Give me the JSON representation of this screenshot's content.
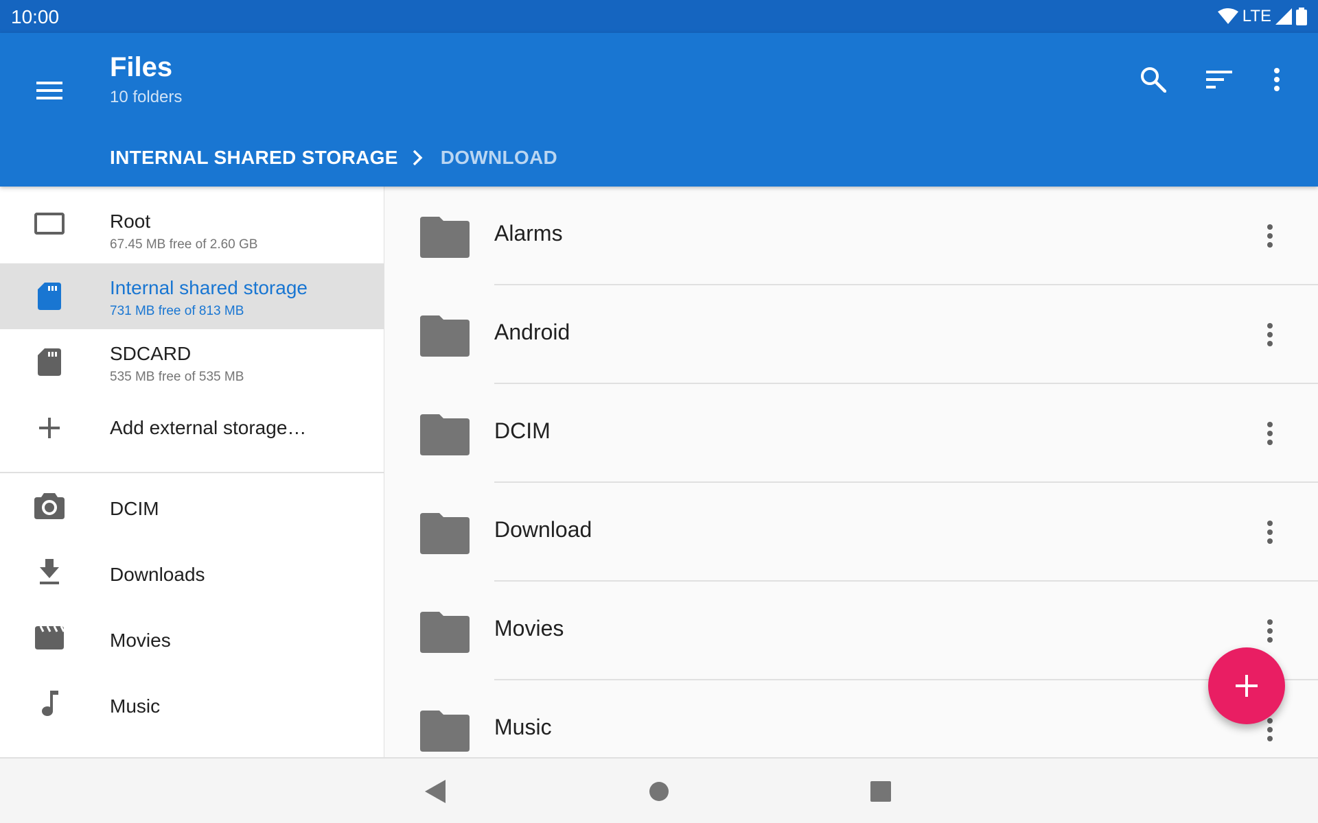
{
  "status_bar": {
    "time": "10:00",
    "network": "LTE",
    "icons": [
      "wifi-icon",
      "signal-icon",
      "battery-icon"
    ]
  },
  "app_bar": {
    "title": "Files",
    "subtitle": "10 folders",
    "actions": [
      "search-icon",
      "sort-icon",
      "more-vert-icon"
    ],
    "breadcrumbs": [
      "INTERNAL SHARED STORAGE",
      "DOWNLOAD"
    ]
  },
  "drawer": {
    "storage": [
      {
        "label": "Root",
        "sub": "67.45 MB free of 2.60 GB",
        "icon": "root-storage-icon"
      },
      {
        "label": "Internal shared storage",
        "sub": "731 MB free of 813 MB",
        "icon": "sd-card-icon",
        "selected": true
      },
      {
        "label": "SDCARD",
        "sub": "535 MB free of 535 MB",
        "icon": "sd-card-icon"
      },
      {
        "label": "Add external storage…",
        "icon": "add-icon"
      }
    ],
    "bookmarks": [
      {
        "label": "DCIM",
        "icon": "camera-icon"
      },
      {
        "label": "Downloads",
        "icon": "download-icon"
      },
      {
        "label": "Movies",
        "icon": "movie-icon"
      },
      {
        "label": "Music",
        "icon": "music-note-icon"
      }
    ]
  },
  "files": [
    {
      "name": "Alarms"
    },
    {
      "name": "Android"
    },
    {
      "name": "DCIM"
    },
    {
      "name": "Download"
    },
    {
      "name": "Movies"
    },
    {
      "name": "Music"
    }
  ],
  "fab": {
    "icon": "add-icon"
  },
  "nav_bar": [
    "back-icon",
    "home-icon",
    "recents-icon"
  ],
  "colors": {
    "primary_dark": "#1565c0",
    "primary": "#1976d2",
    "accent": "#e91e63"
  }
}
